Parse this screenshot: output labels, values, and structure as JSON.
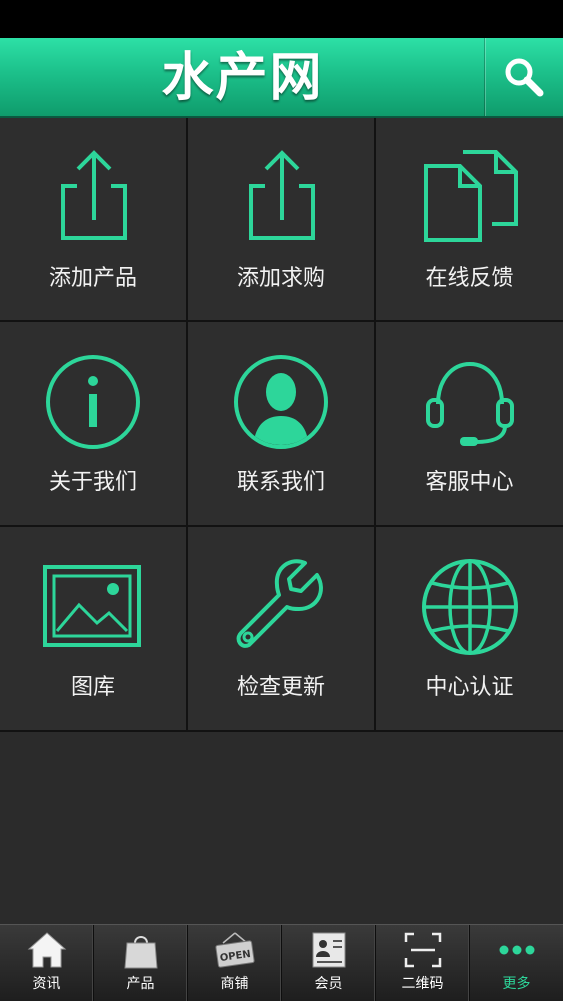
{
  "app": {
    "title": "水产网"
  },
  "colors": {
    "accent": "#2dd69a",
    "header_top": "#2de0a6",
    "header_bottom": "#0f9c6c",
    "background": "#2b2b2b"
  },
  "menu": [
    {
      "label": "添加产品",
      "icon": "upload-icon"
    },
    {
      "label": "添加求购",
      "icon": "upload-icon"
    },
    {
      "label": "在线反馈",
      "icon": "documents-icon"
    },
    {
      "label": "关于我们",
      "icon": "info-icon"
    },
    {
      "label": "联系我们",
      "icon": "contact-person-icon"
    },
    {
      "label": "客服中心",
      "icon": "headset-icon"
    },
    {
      "label": "图库",
      "icon": "image-gallery-icon"
    },
    {
      "label": "检查更新",
      "icon": "wrench-icon"
    },
    {
      "label": "中心认证",
      "icon": "globe-icon"
    }
  ],
  "tabbar": {
    "items": [
      {
        "label": "资讯",
        "icon": "home-icon"
      },
      {
        "label": "产品",
        "icon": "shopping-bag-icon"
      },
      {
        "label": "商铺",
        "icon": "open-sign-icon",
        "icon_text": "OPEN"
      },
      {
        "label": "会员",
        "icon": "member-card-icon"
      },
      {
        "label": "二维码",
        "icon": "qr-scan-icon"
      },
      {
        "label": "更多",
        "icon": "more-dots-icon"
      }
    ],
    "active": "更多"
  }
}
